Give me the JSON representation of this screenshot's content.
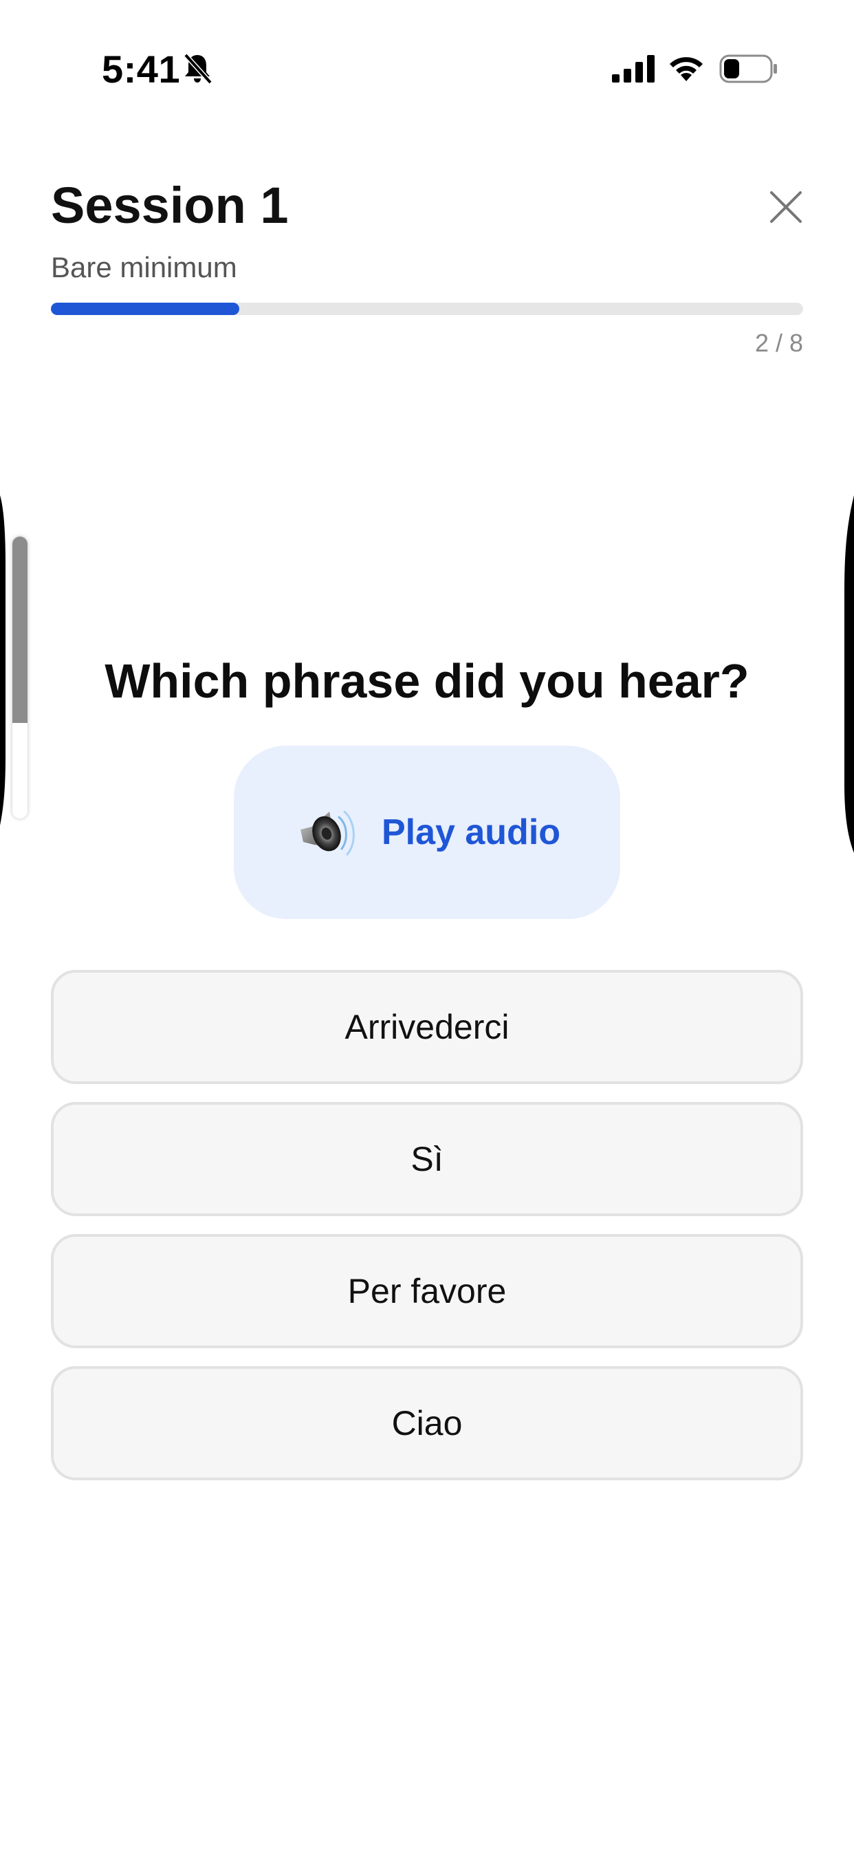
{
  "status_bar": {
    "time": "5:41",
    "icons": [
      "bell-slash-icon",
      "cellular-signal-icon",
      "wifi-icon",
      "battery-icon"
    ]
  },
  "header": {
    "title": "Session 1",
    "subtitle": "Bare minimum",
    "progress_label": "2 / 8",
    "progress_fraction": 0.25,
    "close_icon": "close-icon"
  },
  "question": {
    "prompt": "Which phrase did you hear?",
    "play_label": "Play audio",
    "play_icon": "speaker-icon"
  },
  "options": [
    {
      "label": "Arrivederci"
    },
    {
      "label": "Sì"
    },
    {
      "label": "Per favore"
    },
    {
      "label": "Ciao"
    }
  ],
  "colors": {
    "accent": "#1f56d6",
    "play_button_bg": "#e8effd",
    "option_bg": "#f6f6f6",
    "option_border": "#e2e2e2",
    "progress_track": "#e6e6e6"
  }
}
